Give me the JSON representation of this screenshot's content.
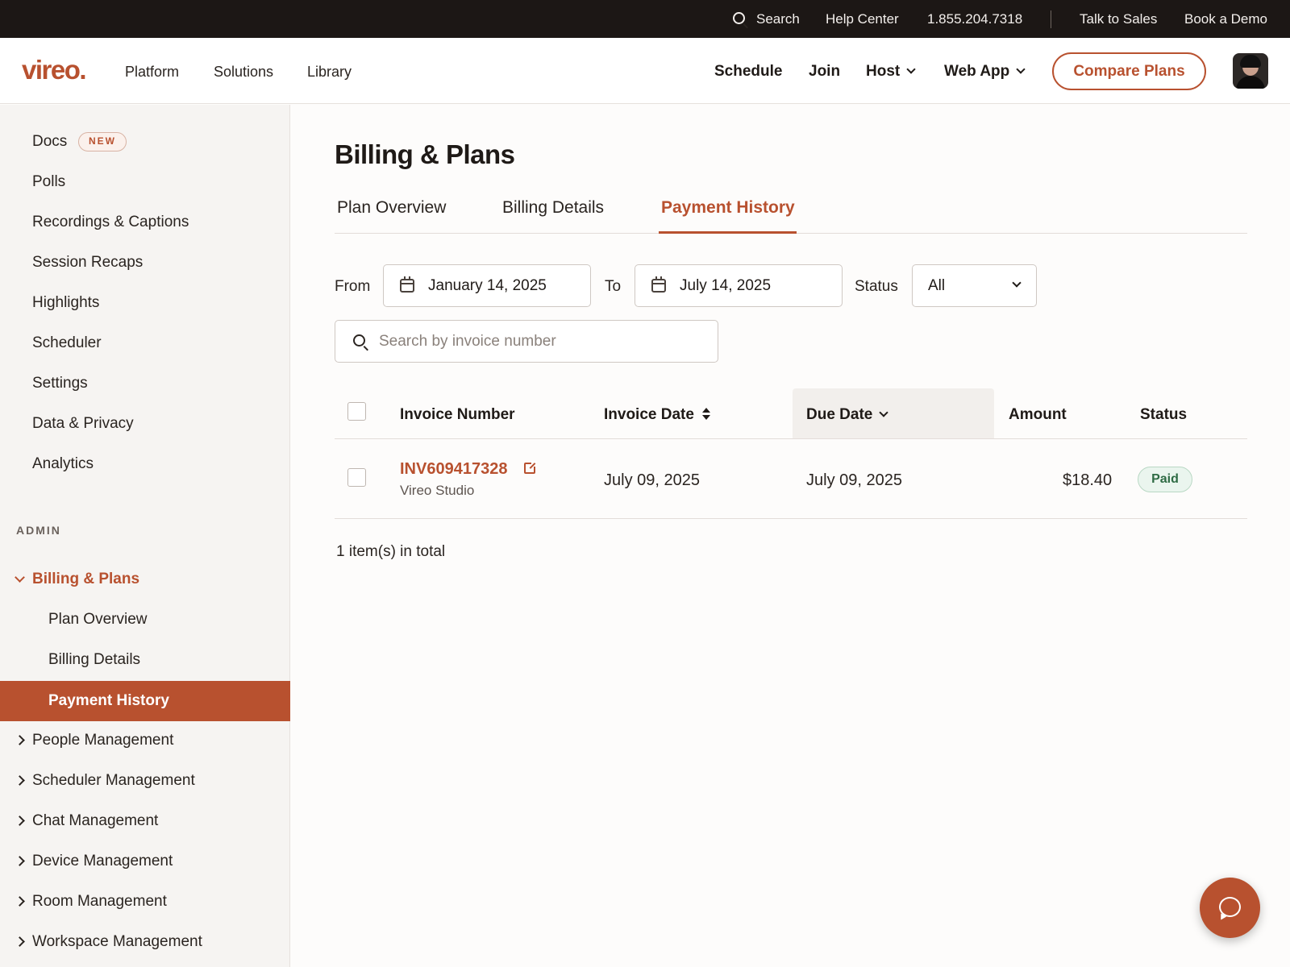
{
  "utility_bar": {
    "search_label": "Search",
    "help_center": "Help Center",
    "phone": "1.855.204.7318",
    "talk_to_sales": "Talk to Sales",
    "book_demo": "Book a Demo"
  },
  "header": {
    "logo": "vireo.",
    "nav_left": [
      "Platform",
      "Solutions",
      "Library"
    ],
    "nav_right": {
      "schedule": "Schedule",
      "join": "Join",
      "host": "Host",
      "web_app": "Web App"
    },
    "compare_plans": "Compare Plans"
  },
  "sidebar": {
    "items": [
      "Docs",
      "Polls",
      "Recordings & Captions",
      "Session Recaps",
      "Highlights",
      "Scheduler",
      "Settings",
      "Data & Privacy",
      "Analytics"
    ],
    "docs_badge": "NEW",
    "admin_heading": "ADMIN",
    "billing_section": "Billing & Plans",
    "billing_sub": [
      "Plan Overview",
      "Billing Details",
      "Payment History"
    ],
    "management": [
      "People Management",
      "Scheduler Management",
      "Chat Management",
      "Device Management",
      "Room Management",
      "Workspace Management"
    ]
  },
  "main": {
    "title": "Billing & Plans",
    "tabs": [
      "Plan Overview",
      "Billing Details",
      "Payment History"
    ],
    "active_tab": "Payment History",
    "filters": {
      "from_label": "From",
      "from_value": "January 14, 2025",
      "to_label": "To",
      "to_value": "July 14, 2025",
      "status_label": "Status",
      "status_value": "All"
    },
    "search_placeholder": "Search by invoice number",
    "table": {
      "headers": {
        "invoice_number": "Invoice Number",
        "invoice_date": "Invoice Date",
        "due_date": "Due Date",
        "amount": "Amount",
        "status": "Status"
      },
      "rows": [
        {
          "invoice_number": "INV609417328",
          "account": "Vireo Studio",
          "invoice_date": "July 09, 2025",
          "due_date": "July 09, 2025",
          "amount": "$18.40",
          "status": "Paid"
        }
      ]
    },
    "total": "1 item(s) in total"
  },
  "colors": {
    "accent": "#b8512f",
    "topbar": "#1c1715",
    "sidebar_bg": "#f6f4f2",
    "paid_green": "#2e6b44"
  },
  "icons": {
    "search": "search-icon",
    "calendar": "calendar-icon",
    "external_link": "external-link-icon",
    "chat": "chat-icon"
  }
}
